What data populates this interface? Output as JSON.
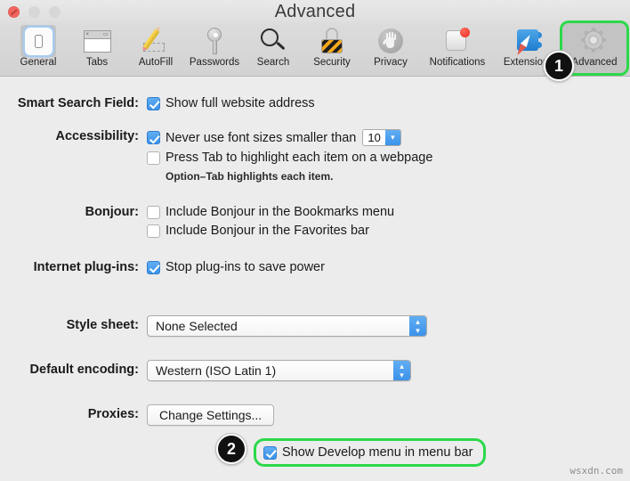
{
  "window": {
    "title": "Advanced",
    "controls": {
      "close": "close-button",
      "minimize": "minimize-button",
      "zoom": "zoom-button"
    }
  },
  "toolbar": {
    "items": [
      {
        "label": "General",
        "icon": "iphone-icon",
        "selected": true,
        "highlighted": false
      },
      {
        "label": "Tabs",
        "icon": "tabs-icon",
        "selected": false,
        "highlighted": false
      },
      {
        "label": "AutoFill",
        "icon": "pencil-form-icon",
        "selected": false,
        "highlighted": false
      },
      {
        "label": "Passwords",
        "icon": "key-icon",
        "selected": false,
        "highlighted": false
      },
      {
        "label": "Search",
        "icon": "magnifier-icon",
        "selected": false,
        "highlighted": false
      },
      {
        "label": "Security",
        "icon": "padlock-icon",
        "selected": false,
        "highlighted": false
      },
      {
        "label": "Privacy",
        "icon": "hand-icon",
        "selected": false,
        "highlighted": false
      },
      {
        "label": "Notifications",
        "icon": "notification-icon",
        "selected": false,
        "highlighted": false
      },
      {
        "label": "Extensions",
        "icon": "puzzle-compass-icon",
        "selected": false,
        "highlighted": false
      },
      {
        "label": "Advanced",
        "icon": "gear-icon",
        "selected": false,
        "highlighted": true
      }
    ]
  },
  "settings": {
    "smart_search_field": {
      "label": "Smart Search Field:",
      "show_full_address": {
        "text": "Show full website address",
        "checked": true
      }
    },
    "accessibility": {
      "label": "Accessibility:",
      "never_use_font_sizes": {
        "text": "Never use font sizes smaller than",
        "checked": true
      },
      "font_size_value": "10",
      "press_tab": {
        "text": "Press Tab to highlight each item on a webpage",
        "checked": false
      },
      "note": "Option–Tab highlights each item."
    },
    "bonjour": {
      "label": "Bonjour:",
      "bookmarks_menu": {
        "text": "Include Bonjour in the Bookmarks menu",
        "checked": false
      },
      "favorites_bar": {
        "text": "Include Bonjour in the Favorites bar",
        "checked": false
      }
    },
    "internet_plugins": {
      "label": "Internet plug-ins:",
      "stop_plugins": {
        "text": "Stop plug-ins to save power",
        "checked": true
      }
    },
    "style_sheet": {
      "label": "Style sheet:",
      "value": "None Selected"
    },
    "default_encoding": {
      "label": "Default encoding:",
      "value": "Western (ISO Latin 1)"
    },
    "proxies": {
      "label": "Proxies:",
      "button": "Change Settings..."
    },
    "develop_menu": {
      "text": "Show Develop menu in menu bar",
      "checked": true
    }
  },
  "annotations": {
    "badges": [
      {
        "number": "1",
        "target": "advanced-toolbar-item"
      },
      {
        "number": "2",
        "target": "develop-menu-checkbox"
      }
    ],
    "highlight_color": "#2bd94a"
  },
  "watermark": "wsxdn.com"
}
